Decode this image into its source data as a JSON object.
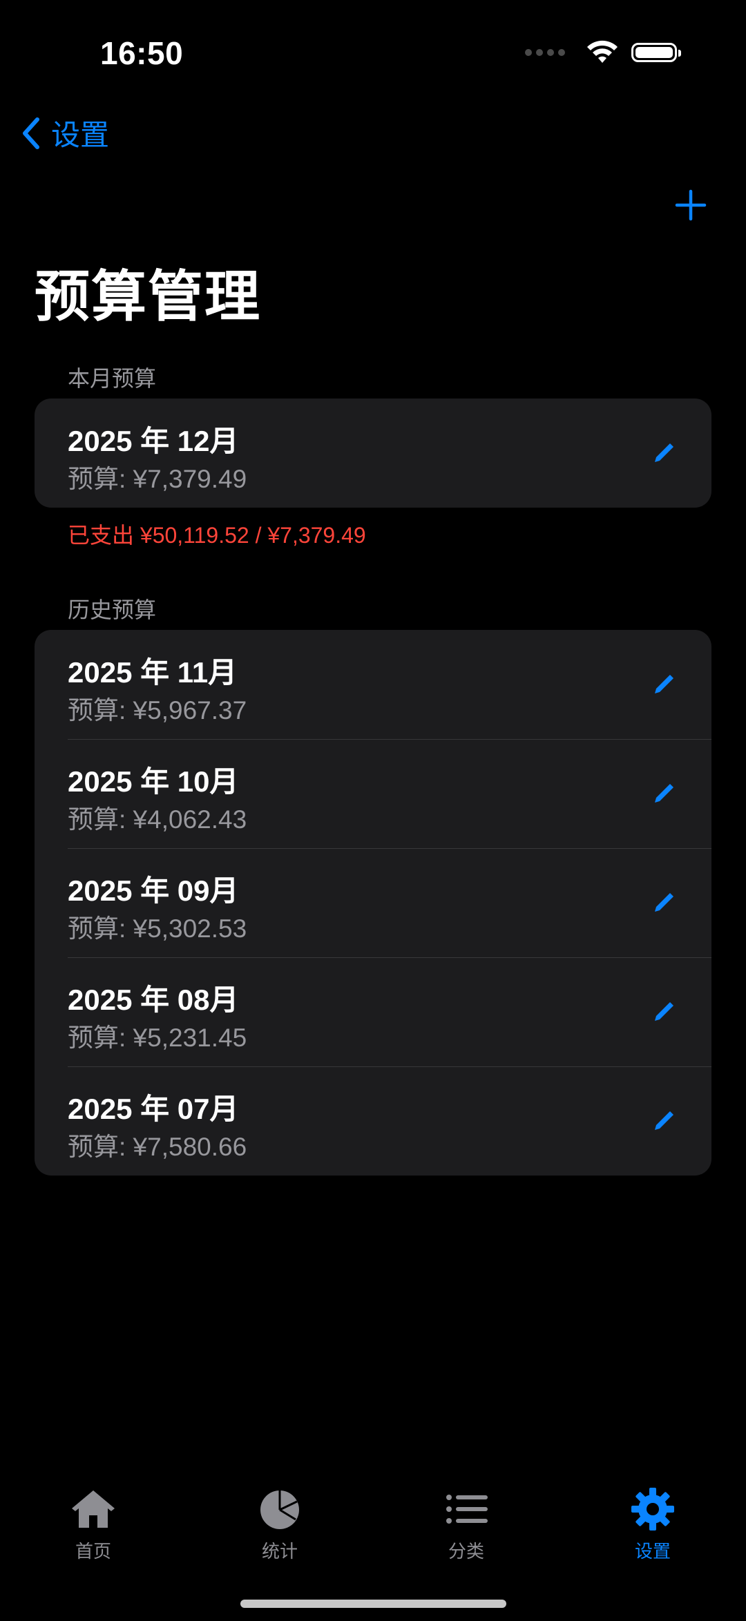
{
  "status_bar": {
    "time": "16:50"
  },
  "nav": {
    "back_label": "设置",
    "add_icon": "plus-icon"
  },
  "title": "预算管理",
  "current_section": {
    "header": "本月预算",
    "item": {
      "month": "2025 年 12月",
      "budget": "预算: ¥7,379.49"
    },
    "spent": "已支出 ¥50,119.52 / ¥7,379.49"
  },
  "history_section": {
    "header": "历史预算",
    "items": [
      {
        "month": "2025 年 11月",
        "budget": "预算: ¥5,967.37"
      },
      {
        "month": "2025 年 10月",
        "budget": "预算: ¥4,062.43"
      },
      {
        "month": "2025 年 09月",
        "budget": "预算: ¥5,302.53"
      },
      {
        "month": "2025 年 08月",
        "budget": "预算: ¥5,231.45"
      },
      {
        "month": "2025 年 07月",
        "budget": "预算: ¥7,580.66"
      }
    ]
  },
  "tabs": [
    {
      "label": "首页",
      "icon": "house-icon"
    },
    {
      "label": "统计",
      "icon": "pie-chart-icon"
    },
    {
      "label": "分类",
      "icon": "list-icon"
    },
    {
      "label": "设置",
      "icon": "gear-icon",
      "active": true
    }
  ],
  "colors": {
    "accent": "#0a84ff",
    "alert": "#ff453a",
    "card": "#1c1c1e",
    "secondary_text": "#98989d"
  }
}
